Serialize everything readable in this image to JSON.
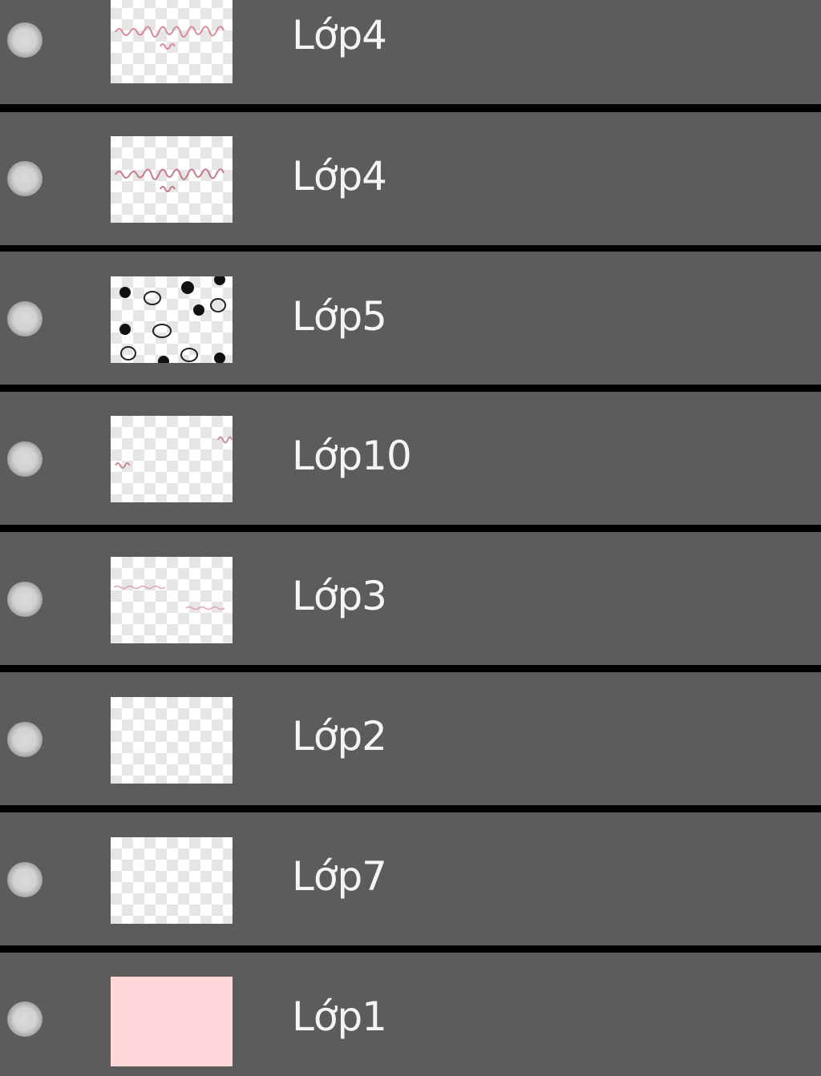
{
  "layers_panel": {
    "colors": {
      "row_background": "#5c5c5c",
      "separator": "#000000",
      "label_text": "#f4f4f4",
      "visibility_dot": "#d2d2d2",
      "solid_fill_layer": "#ffd9d9"
    },
    "layers": [
      {
        "name": "Lớp4",
        "visibility_icon": "visibility-dot-icon",
        "thumbnail": "pink-handwriting-thumbnail"
      },
      {
        "name": "Lớp4",
        "visibility_icon": "visibility-dot-icon",
        "thumbnail": "pink-handwriting-thumbnail"
      },
      {
        "name": "Lớp5",
        "visibility_icon": "visibility-dot-icon",
        "thumbnail": "dots-and-doodles-thumbnail"
      },
      {
        "name": "Lớp10",
        "visibility_icon": "visibility-dot-icon",
        "thumbnail": "small-pink-marks-thumbnail"
      },
      {
        "name": "Lớp3",
        "visibility_icon": "visibility-dot-icon",
        "thumbnail": "faint-pink-lines-thumbnail"
      },
      {
        "name": "Lớp2",
        "visibility_icon": "visibility-dot-icon",
        "thumbnail": "transparent-thumbnail"
      },
      {
        "name": "Lớp7",
        "visibility_icon": "visibility-dot-icon",
        "thumbnail": "transparent-thumbnail"
      },
      {
        "name": "Lớp1",
        "visibility_icon": "visibility-dot-icon",
        "thumbnail": "solid-pink-thumbnail"
      }
    ]
  }
}
